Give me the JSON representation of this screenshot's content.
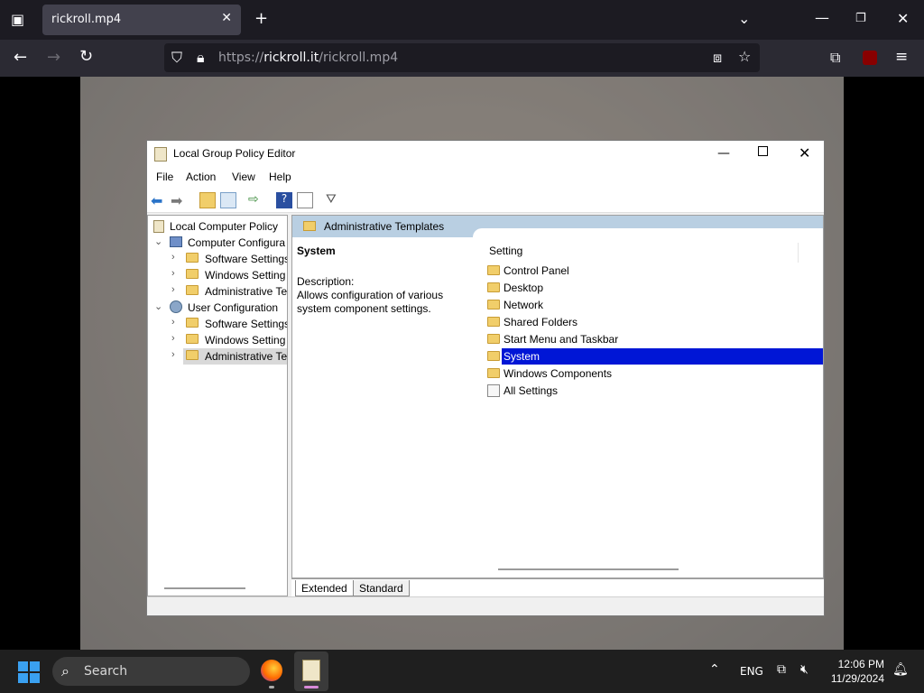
{
  "browser": {
    "tab_title": "rickroll.mp4",
    "url_prefix": "https://",
    "url_host": "rickroll.it",
    "url_path": "/rickroll.mp4"
  },
  "window": {
    "title": "Local Group Policy Editor",
    "menu": [
      "File",
      "Action",
      "View",
      "Help"
    ]
  },
  "tree": {
    "root": "Local Computer Policy",
    "computer_config": "Computer Configura",
    "cc_software": "Software Settings",
    "cc_windows": "Windows Setting",
    "cc_admin": "Administrative Te",
    "user_config": "User Configuration",
    "uc_software": "Software Settings",
    "uc_windows": "Windows Setting",
    "uc_admin": "Administrative Te"
  },
  "pane": {
    "header": "Administrative Templates",
    "title": "System",
    "desc_label": "Description:",
    "desc_text": "Allows configuration of various system component settings.",
    "column": "Setting",
    "items": [
      "Control Panel",
      "Desktop",
      "Network",
      "Shared Folders",
      "Start Menu and Taskbar",
      "System",
      "Windows Components",
      "All Settings"
    ]
  },
  "view_tabs": {
    "extended": "Extended",
    "standard": "Standard"
  },
  "taskbar": {
    "search": "Search",
    "lang": "ENG",
    "time": "12:06 PM",
    "date": "11/29/2024"
  }
}
